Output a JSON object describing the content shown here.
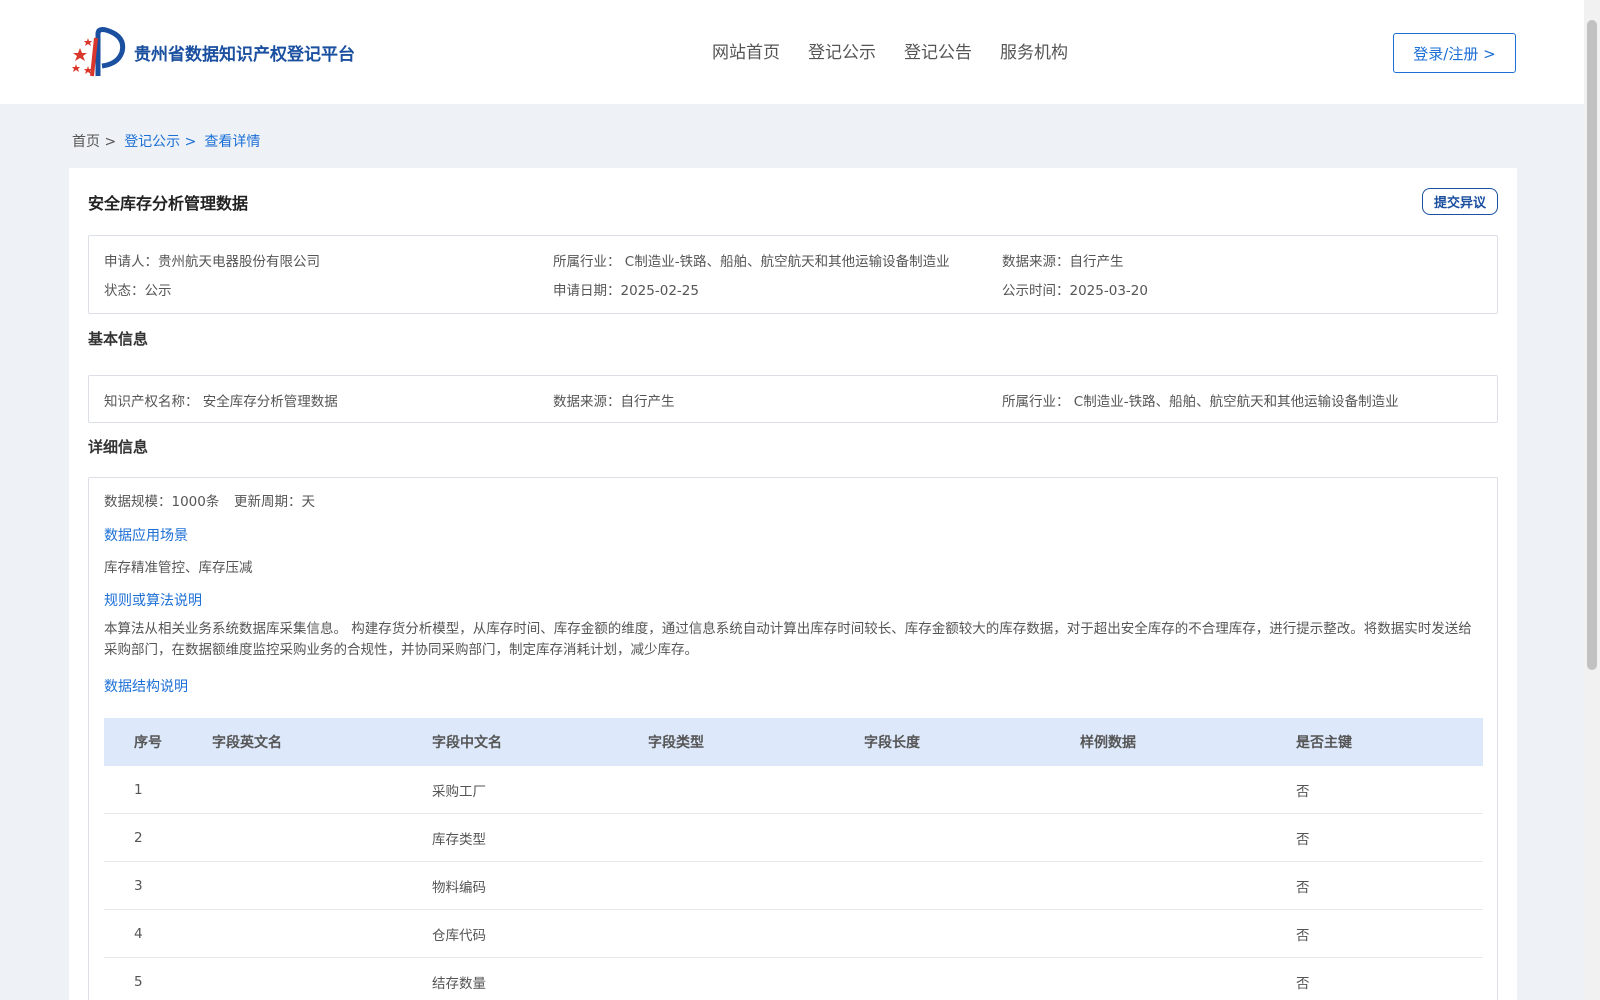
{
  "header": {
    "logo_text": "贵州省数据知识产权登记平台",
    "nav": [
      "网站首页",
      "登记公示",
      "登记公告",
      "服务机构"
    ],
    "login_label": "登录/注册 >"
  },
  "breadcrumb": {
    "home": "首页 >",
    "list": "登记公示 >",
    "current": "查看详情"
  },
  "record": {
    "title": "安全库存分析管理数据",
    "objection_label": "提交异议",
    "summary": {
      "applicant_label": "申请人：",
      "applicant": "贵州航天电器股份有限公司",
      "industry_label": "所属行业：",
      "industry": "C制造业-铁路、船舶、航空航天和其他运输设备制造业",
      "source_label": "数据来源：",
      "source": "自行产生",
      "status_label": "状态：",
      "status": "公示",
      "apply_date_label": "申请日期：",
      "apply_date": "2025-02-25",
      "publish_time_label": "公示时间：",
      "publish_time": "2025-03-20"
    },
    "basic": {
      "section_title": "基本信息",
      "ip_name_label": "知识产权名称：",
      "ip_name": "安全库存分析管理数据",
      "source_label": "数据来源：",
      "source": "自行产生",
      "industry_label": "所属行业：",
      "industry": "C制造业-铁路、船舶、航空航天和其他运输设备制造业"
    },
    "detail": {
      "section_title": "详细信息",
      "scale_label": "数据规模：",
      "scale": "1000条",
      "cycle_label": "更新周期：",
      "cycle": "天",
      "scenario_title": "数据应用场景",
      "scenario_text": "库存精准管控、库存压减",
      "algorithm_title": "规则或算法说明",
      "algorithm_text": "本算法从相关业务系统数据库采集信息。 构建存货分析模型，从库存时间、库存金额的维度，通过信息系统自动计算出库存时间较长、库存金额较大的库存数据，对于超出安全库存的不合理库存，进行提示整改。将数据实时发送给采购部门，在数据额维度监控采购业务的合规性，并协同采购部门，制定库存消耗计划，减少库存。",
      "structure_title": "数据结构说明",
      "table": {
        "headers": [
          "序号",
          "字段英文名",
          "字段中文名",
          "字段类型",
          "字段长度",
          "样例数据",
          "是否主键"
        ],
        "rows": [
          [
            "1",
            "",
            "采购工厂",
            "",
            "",
            "",
            "否"
          ],
          [
            "2",
            "",
            "库存类型",
            "",
            "",
            "",
            "否"
          ],
          [
            "3",
            "",
            "物料编码",
            "",
            "",
            "",
            "否"
          ],
          [
            "4",
            "",
            "仓库代码",
            "",
            "",
            "",
            "否"
          ],
          [
            "5",
            "",
            "结存数量",
            "",
            "",
            "",
            "否"
          ]
        ]
      }
    }
  },
  "colors": {
    "brand": "#1b4fa0",
    "link": "#1b6fd6",
    "table_header_bg": "#dde9fb"
  }
}
